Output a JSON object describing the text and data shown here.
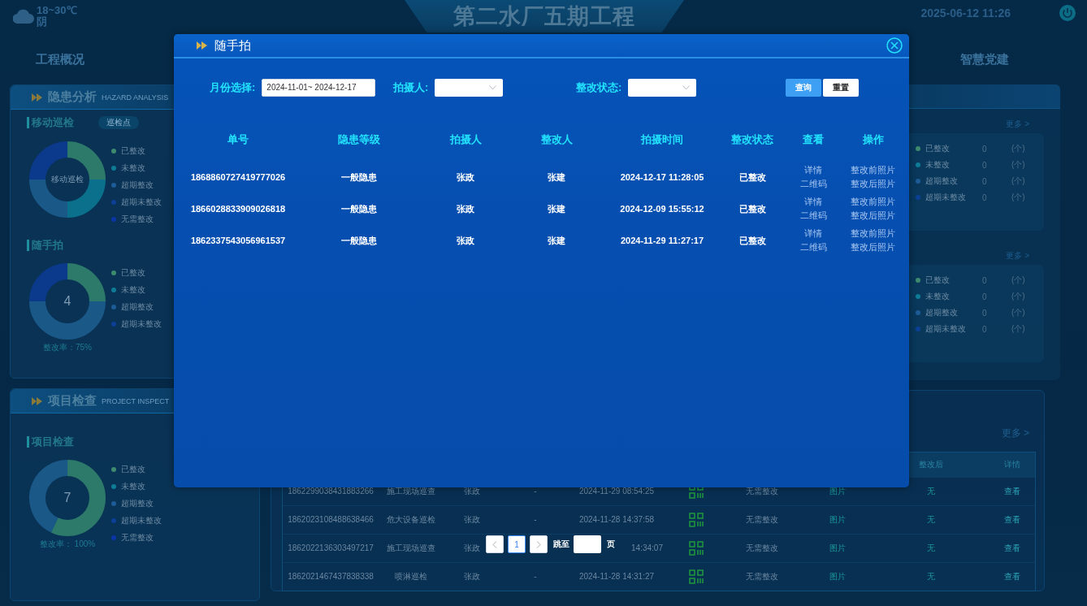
{
  "header": {
    "temperature": "18~30℃",
    "weather": "阴",
    "title": "第二水厂五期工程",
    "datetime": "2025-06-12 11:26"
  },
  "nav": {
    "left": "工程概况",
    "right": "智慧党建"
  },
  "left_panels": [
    {
      "title": "隐患分析",
      "subtitle": "HAZARD ANALYSIS",
      "sections": [
        {
          "kind": "patrol",
          "title": "移动巡检",
          "tag": "巡检点",
          "center": "移动巡检",
          "legend": [
            {
              "label": "已整改",
              "color": "#3e8a6e"
            },
            {
              "label": "未整改",
              "color": "#0e7c96"
            },
            {
              "label": "超期整改",
              "color": "#1d5c96"
            },
            {
              "label": "超期未整改",
              "color": "#0c3f96"
            },
            {
              "label": "无需整改",
              "color": "#0b36a6"
            }
          ]
        },
        {
          "kind": "photo",
          "title": "随手拍",
          "center": "4",
          "rate": "整改率：75%",
          "legend": [
            {
              "label": "已整改",
              "color": "#3e8a6e"
            },
            {
              "label": "未整改",
              "color": "#0e7c96"
            },
            {
              "label": "超期整改",
              "color": "#1d5c96"
            },
            {
              "label": "超期未整改",
              "color": "#0c3f96"
            }
          ]
        }
      ]
    },
    {
      "title": "项目检查",
      "subtitle": "PROJECT INSPECT",
      "sections": [
        {
          "kind": "project",
          "title": "项目检查",
          "center": "7",
          "rate": "整改率： 100%",
          "legend": [
            {
              "label": "已整改",
              "color": "#3e8a6e"
            },
            {
              "label": "未整改",
              "color": "#0e7c96"
            },
            {
              "label": "超期整改",
              "color": "#1d5c96"
            },
            {
              "label": "超期未整改",
              "color": "#0c3f96"
            },
            {
              "label": "无需整改",
              "color": "#0b36a6"
            }
          ]
        }
      ]
    }
  ],
  "right_groups": [
    {
      "more": "更多 >",
      "legend": [
        {
          "label": "已整改",
          "value": "0",
          "unit": "(个)",
          "color": "#3e8a6e"
        },
        {
          "label": "未整改",
          "value": "0",
          "unit": "(个)",
          "color": "#0e7c96"
        },
        {
          "label": "超期整改",
          "value": "0",
          "unit": "(个)",
          "color": "#1d5c96"
        },
        {
          "label": "超期未整改",
          "value": "0",
          "unit": "(个)",
          "color": "#0c3f96"
        }
      ]
    },
    {
      "more": "更多 >",
      "legend": [
        {
          "label": "已整改",
          "value": "0",
          "unit": "(个)",
          "color": "#3e8a6e"
        },
        {
          "label": "未整改",
          "value": "0",
          "unit": "(个)",
          "color": "#0e7c96"
        },
        {
          "label": "超期整改",
          "value": "0",
          "unit": "(个)",
          "color": "#1d5c96"
        },
        {
          "label": "超期未整改",
          "value": "0",
          "unit": "(个)",
          "color": "#0c3f96"
        }
      ]
    }
  ],
  "hazard_table": {
    "more": "更多 >",
    "columns": [
      "整改后",
      "详情"
    ],
    "rows": [
      {
        "id": "1862299038431883266",
        "point": "施工现场巡查",
        "inspector": "张政",
        "reviser": "-",
        "time": "2024-11-29 08:54:25",
        "time_partly_hidden": false,
        "status": "无需整改",
        "before": "图片",
        "after": "无",
        "detail": "查看"
      },
      {
        "id": "1862023108488638466",
        "point": "危大设备巡检",
        "inspector": "张政",
        "reviser": "-",
        "time": "2024-11-28 14:37:58",
        "time_partly_hidden": false,
        "status": "无需整改",
        "before": "图片",
        "after": "无",
        "detail": "查看"
      },
      {
        "id": "1862022136303497217",
        "point": "施工现场巡查",
        "inspector": "张政",
        "time": "14:34:07",
        "time_partly_hidden": true,
        "status": "无需整改",
        "before": "图片",
        "after": "无",
        "detail": "查看"
      },
      {
        "id": "1862021467437838338",
        "point": "喷淋巡检",
        "inspector": "张政",
        "reviser": "-",
        "time": "2024-11-28 14:31:27",
        "time_partly_hidden": false,
        "status": "无需整改",
        "before": "图片",
        "after": "无",
        "detail": "查看"
      }
    ]
  },
  "modal": {
    "title": "随手拍",
    "filters": [
      {
        "kind": "text",
        "label": "月份选择:",
        "value": "2024-11-01~ 2024-12-17"
      },
      {
        "kind": "select",
        "label": "拍摄人:"
      },
      {
        "kind": "select",
        "label": "整改状态:"
      }
    ],
    "buttons": [
      {
        "kind": "primary",
        "label": "查询"
      },
      {
        "kind": "default",
        "label": "重置"
      }
    ],
    "columns": [
      "单号",
      "隐患等级",
      "拍摄人",
      "整改人",
      "拍摄时间",
      "整改状态",
      "查看",
      "操作"
    ],
    "rows": [
      {
        "id": "1868860727419777026",
        "level": "一般隐患",
        "photographer": "张政",
        "reviser": "张建",
        "time": "2024-12-17 11:28:05",
        "status": "已整改",
        "view": [
          "详情",
          "二维码"
        ],
        "actions": [
          "整改前照片",
          "整改后照片"
        ]
      },
      {
        "id": "1866028833909026818",
        "level": "一般隐患",
        "photographer": "张政",
        "reviser": "张建",
        "time": "2024-12-09 15:55:12",
        "status": "已整改",
        "view": [
          "详情",
          "二维码"
        ],
        "actions": [
          "整改前照片",
          "整改后照片"
        ]
      },
      {
        "id": "1862337543056961537",
        "level": "一般隐患",
        "photographer": "张政",
        "reviser": "张建",
        "time": "2024-11-29 11:27:17",
        "status": "已整改",
        "view": [
          "详情",
          "二维码"
        ],
        "actions": [
          "整改前照片",
          "整改后照片"
        ]
      }
    ],
    "pagination": {
      "pages": [
        {
          "label": "1",
          "selected": true
        }
      ],
      "jump_label": "跳至",
      "unit": "页"
    }
  }
}
